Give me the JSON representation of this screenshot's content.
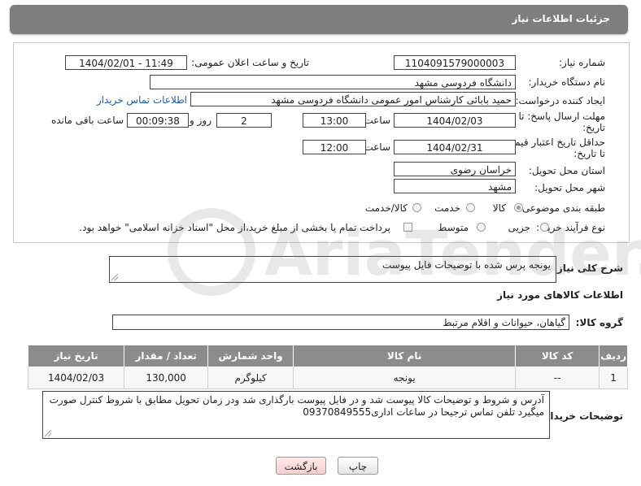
{
  "header": {
    "title": "جزئیات اطلاعات نیاز"
  },
  "form": {
    "need_number_label": "شماره نیاز:",
    "need_number": "1104091579000003",
    "announce_label": "تاریخ و ساعت اعلان عمومی:",
    "announce_value": "1404/02/01 - 11:49",
    "buyer_org_label": "نام دستگاه خریدار:",
    "buyer_org": "دانشگاه فردوسی مشهد",
    "creator_label": "ایجاد کننده درخواست:",
    "creator": "حمید بابائی کارشناس امور عمومی دانشگاه فردوسی مشهد",
    "contact_link": "اطلاعات تماس خریدار",
    "reply_deadline_label": "مهلت ارسال پاسخ: تا",
    "reply_deadline_label2": "تاریخ:",
    "reply_date": "1404/02/03",
    "time_label": "ساعت",
    "reply_time": "13:00",
    "days_value": "2",
    "days_label": "روز و",
    "remaining_time": "00:09:38",
    "remaining_label": "ساعت باقی مانده",
    "price_validity_label": "حداقل تاریخ اعتبار قیمت:",
    "price_validity_label2": "تا تاریخ:",
    "validity_date": "1404/02/31",
    "validity_time_label": "ساعت",
    "validity_time": "12:00",
    "province_label": "استان محل تحویل:",
    "province": "خراسان رضوی",
    "city_label": "شهر محل تحویل:",
    "city": "مشهد",
    "category_label": "طبقه بندی موضوعی:",
    "category_options": [
      "کالا",
      "خدمت",
      "کالا/خدمت"
    ],
    "category_selected": "کالا",
    "process_label": "نوع فرآیند خرید :",
    "process_options": [
      "جزیی",
      "متوسط"
    ],
    "process_note": "پرداخت تمام یا بخشی از مبلغ خرید،از محل \"اسناد خزانه اسلامی\" خواهد بود."
  },
  "description": {
    "label": "شرح کلی نیاز:",
    "text": "یونجه پرس شده با توضیحات فایل پیوست"
  },
  "goods": {
    "section_title": "اطلاعات کالاهای مورد نیاز",
    "group_label": "گروه کالا:",
    "group_value": "گیاهان، حیوانات و اقلام مرتبط",
    "columns": [
      "ردیف",
      "کد کالا",
      "نام کالا",
      "واحد شمارش",
      "تعداد / مقدار",
      "تاریخ نیاز"
    ],
    "rows": [
      [
        "1",
        "--",
        "یونجه",
        "کیلوگرم",
        "130,000",
        "1404/02/03"
      ]
    ]
  },
  "buyer_notes": {
    "label": "توضیحات خریدار:",
    "text": "آدرس و شروط  و توضیحات کالا پیوست شد و در فایل پیوست بارگذاری شد ودر زمان تحویل مطابق با شروط کنترل صورت میگیرد تلفن تماس  ترجیحا در ساعات اداری09370849555"
  },
  "buttons": {
    "print": "چاپ",
    "back": "بازگشت"
  },
  "watermark": {
    "text": "AriaTender.net"
  }
}
